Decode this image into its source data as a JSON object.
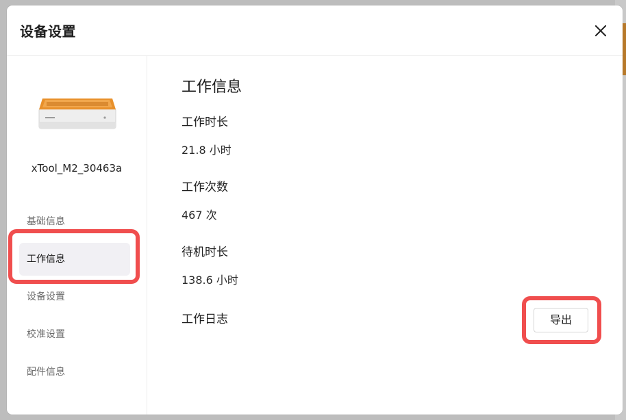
{
  "modal": {
    "title": "设备设置"
  },
  "sidebar": {
    "device_name": "xTool_M2_30463a",
    "items": [
      {
        "label": "基础信息",
        "active": false
      },
      {
        "label": "工作信息",
        "active": true
      },
      {
        "label": "设备设置",
        "active": false
      },
      {
        "label": "校准设置",
        "active": false
      },
      {
        "label": "配件信息",
        "active": false
      }
    ]
  },
  "main": {
    "section_title": "工作信息",
    "fields": [
      {
        "label": "工作时长",
        "value": "21.8 小时"
      },
      {
        "label": "工作次数",
        "value": "467 次"
      },
      {
        "label": "待机时长",
        "value": "138.6 小时"
      }
    ],
    "log": {
      "label": "工作日志",
      "export_label": "导出"
    }
  },
  "colors": {
    "highlight": "#f04e4e",
    "device_orange": "#e8902a",
    "active_nav_bg": "#f1f0f4"
  },
  "icons": [
    "close-icon",
    "laser-engraver-device-image"
  ]
}
